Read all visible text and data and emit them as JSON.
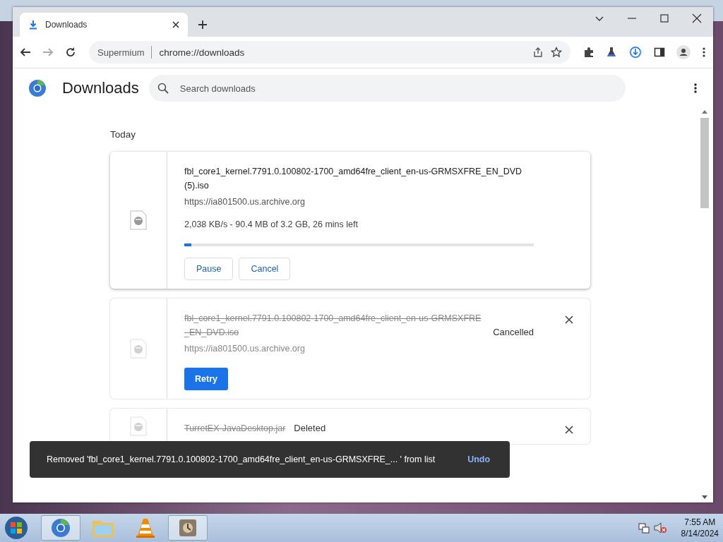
{
  "window": {
    "tab_title": "Downloads",
    "site_name": "Supermium",
    "url": "chrome://downloads"
  },
  "page": {
    "title": "Downloads",
    "search": {
      "placeholder": "Search downloads"
    },
    "section": "Today"
  },
  "downloads": [
    {
      "kind": "active",
      "name": "fbl_core1_kernel.7791.0.100802-1700_amd64fre_client_en-us-GRMSXFRE_EN_DVD (5).iso",
      "url": "https://ia801500.us.archive.org",
      "progress_text": "2,038 KB/s - 90.4 MB of 3.2 GB, 26 mins left",
      "level": 0.02,
      "buttons": [
        "Pause",
        "Cancel"
      ]
    },
    {
      "kind": "cancelled",
      "name": "fbl_core1_kernel.7791.0.100802-1700_amd64fre_client_en-us-GRMSXFRE_EN_DVD.iso",
      "status": "Cancelled",
      "url": "https://ia801500.us.archive.org",
      "buttons": [
        "Retry"
      ]
    },
    {
      "kind": "deleted",
      "name": "TurretEX-JavaDesktop.jar",
      "status": "Deleted"
    }
  ],
  "toast": {
    "message": "Removed 'fbl_core1_kernel.7791.0.100802-1700_amd64fre_client_en-us-GRMSXFRE_... ' from list",
    "action": "Undo"
  },
  "taskbar": {
    "time": "7:55 AM",
    "date": "8/14/2024"
  }
}
